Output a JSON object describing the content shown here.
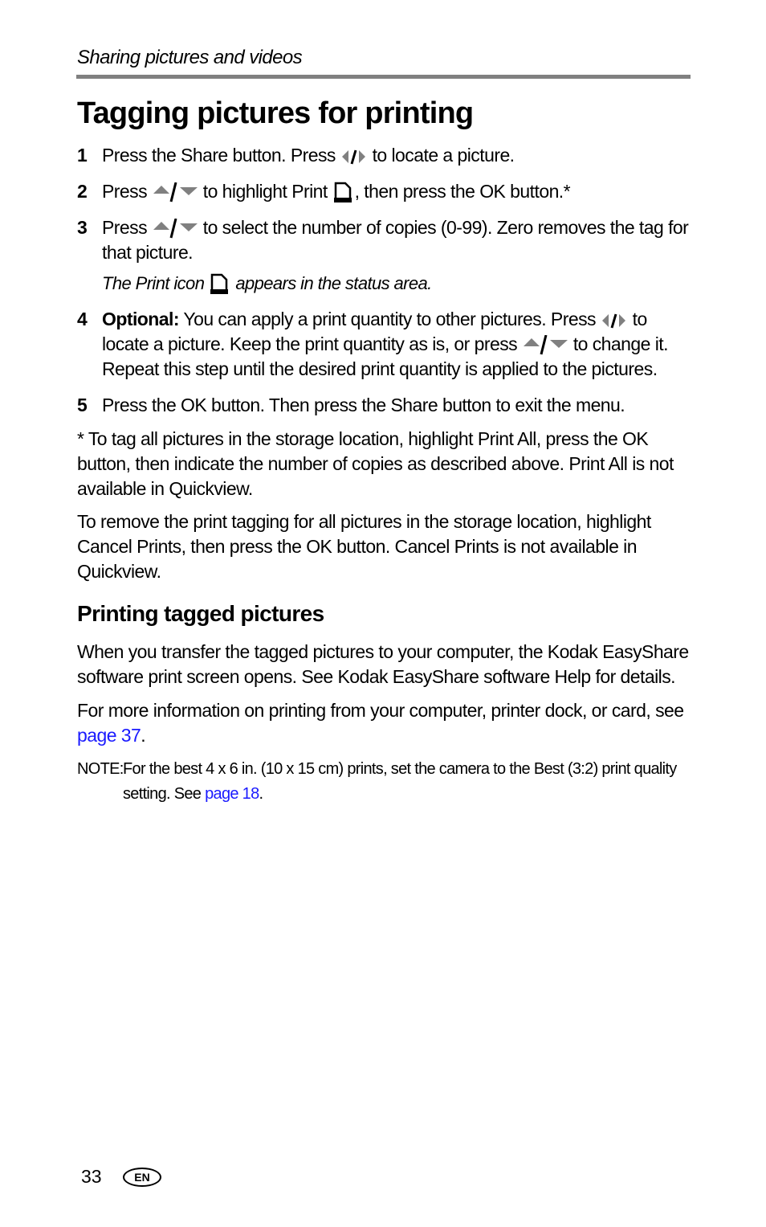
{
  "header": {
    "running_head": "Sharing pictures and videos"
  },
  "title": "Tagging pictures for printing",
  "steps": [
    {
      "num": "1",
      "parts": [
        "Press the Share button. Press",
        "to locate a picture."
      ]
    },
    {
      "num": "2",
      "parts": [
        "Press",
        "to highlight Print",
        ", then press the OK button.*"
      ]
    },
    {
      "num": "3",
      "parts": [
        "Press",
        "to select the number of copies (0-99). Zero removes the tag for that picture."
      ]
    },
    {
      "num": "4",
      "bold": "Optional:",
      "parts": [
        "You can apply a print quantity to other pictures. Press",
        "to locate a picture. Keep the print quantity as is, or press",
        "to change it. Repeat this step until the desired print quantity is applied to the pictures."
      ]
    },
    {
      "num": "5",
      "parts": [
        "Press the OK button. Then press the Share button to exit the menu."
      ]
    }
  ],
  "step3_note": {
    "before": "The Print icon",
    "after": "appears in the status area."
  },
  "footnote": "* To tag all pictures in the storage location, highlight Print All, press the OK button, then indicate the number of copies as described above. Print All is not available in Quickview.",
  "cancel_para": "To remove the print tagging for all pictures in the storage location, highlight Cancel Prints, then press the OK button. Cancel Prints is not available in Quickview.",
  "section": {
    "heading": "Printing tagged pictures",
    "para1": "When you transfer the tagged pictures to your computer, the Kodak EasyShare software print screen opens. See Kodak EasyShare software Help for details.",
    "para2_before": "For more information on printing from your computer, printer dock, or card, see",
    "para2_link": "page 37",
    "para2_after": "."
  },
  "note": {
    "label": "NOTE:",
    "text": "For the best 4 x 6 in. (10 x 15 cm) prints, set the camera to the Best (3:2) print quality setting. See",
    "link": "page 18",
    "after": "."
  },
  "footer": {
    "page_number": "33",
    "language_badge": "EN"
  },
  "icons": {
    "left_right": "left-right-arrows-icon",
    "up_down": "up-down-arrows-icon",
    "print": "print-icon"
  },
  "colors": {
    "link": "#1a1aff",
    "rule": "#808080",
    "arrow": "#808080"
  }
}
